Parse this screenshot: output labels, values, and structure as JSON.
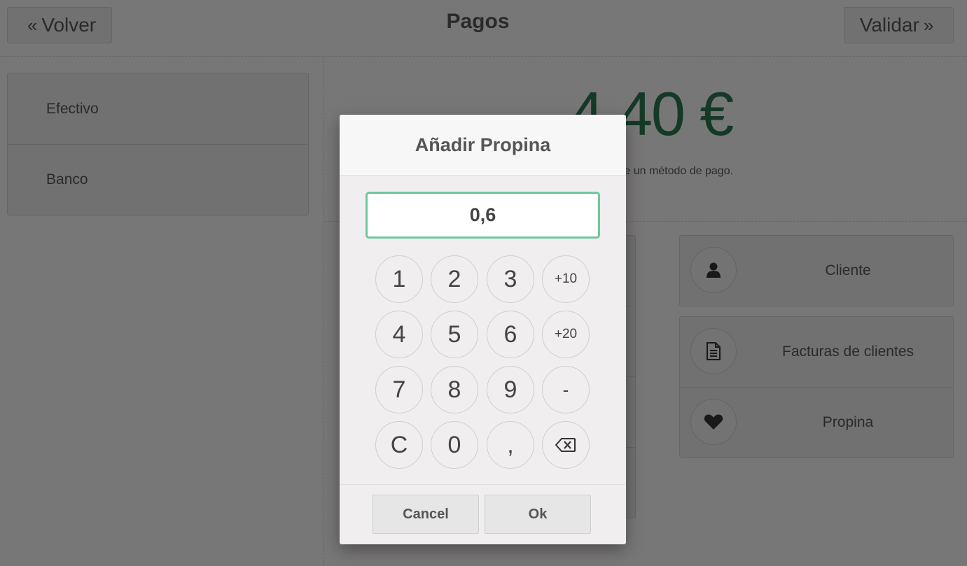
{
  "header": {
    "back_label": "Volver",
    "back_icon": "double-chevron-left-icon",
    "title": "Pagos",
    "validate_label": "Validar",
    "validate_icon": "double-chevron-right-icon"
  },
  "payment_methods": [
    {
      "label": "Efectivo"
    },
    {
      "label": "Banco"
    }
  ],
  "summary": {
    "due_amount": "4,40 €",
    "hint": "ione un método de pago."
  },
  "actions": [
    {
      "label": "Cliente",
      "icon": "user-icon"
    },
    {
      "label": "Facturas de clientes",
      "icon": "document-icon"
    },
    {
      "label": "Propina",
      "icon": "heart-icon"
    }
  ],
  "dialog": {
    "title": "Añadir Propina",
    "value": "0,6",
    "keys": [
      [
        "1",
        "2",
        "3",
        "+10"
      ],
      [
        "4",
        "5",
        "6",
        "+20"
      ],
      [
        "7",
        "8",
        "9",
        "-"
      ],
      [
        "C",
        "0",
        ",",
        "backspace-icon"
      ]
    ],
    "cancel_label": "Cancel",
    "ok_label": "Ok"
  },
  "colors": {
    "accent_green": "#28744e",
    "focus_border": "#6ec89b",
    "overlay": "rgba(0,0,0,0.5)"
  }
}
